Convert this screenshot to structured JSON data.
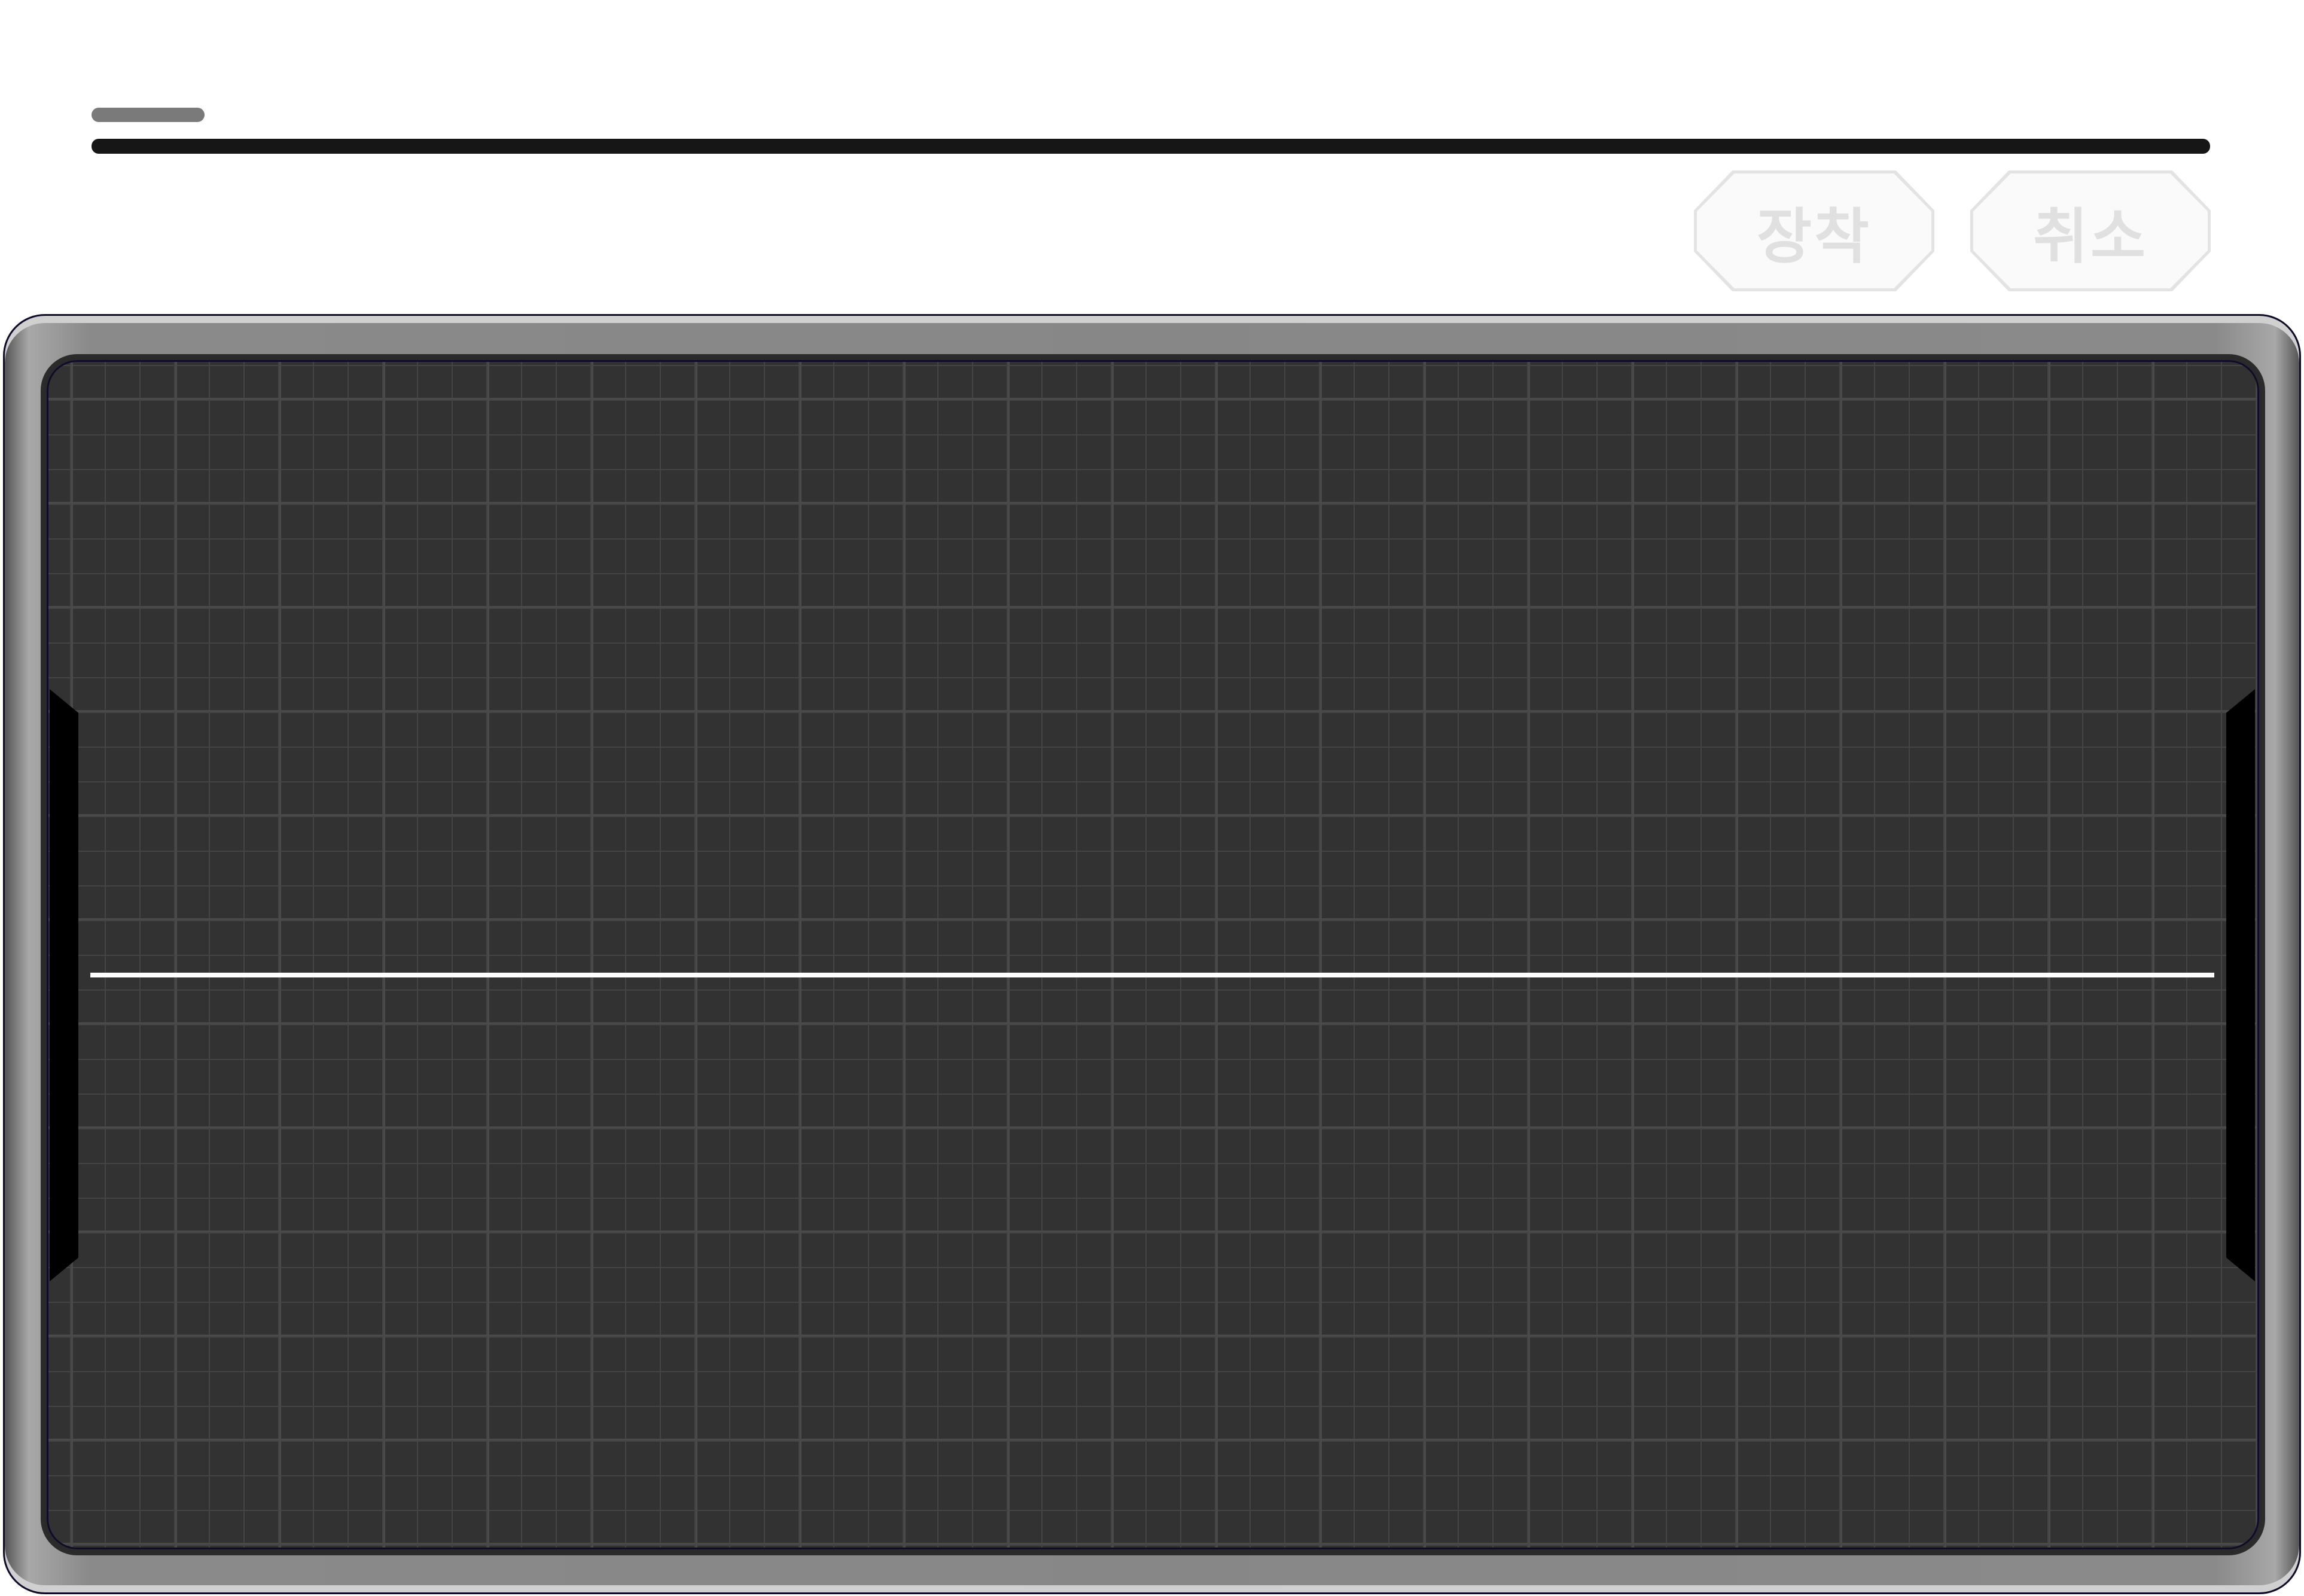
{
  "actions": {
    "equip_label": "장착",
    "cancel_label": "취소"
  },
  "colors": {
    "screen_bg": "#323232",
    "trace": "#ffffff",
    "bezel": "#878787",
    "button_fill": "#fafafa",
    "button_text": "#e0e0e0"
  }
}
